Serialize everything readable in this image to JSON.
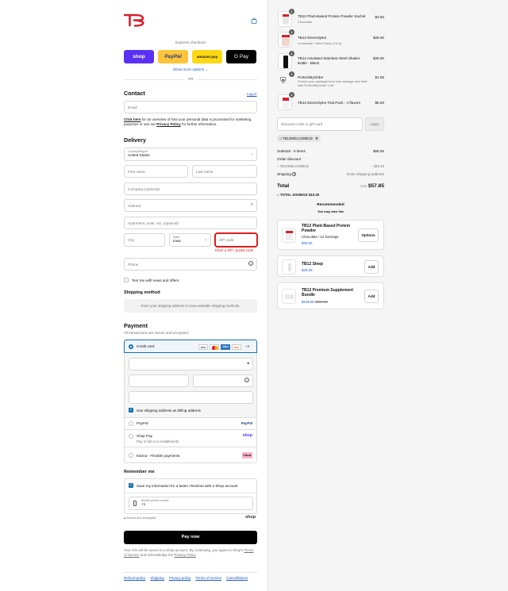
{
  "header": {
    "logo_text": "TB12",
    "cart_icon": "shopping-bag-icon"
  },
  "express": {
    "label": "Express checkout",
    "shop_label": "shop",
    "paypal_label": "PayPal",
    "amazon_label": "amazon pay",
    "gpay_label": "G Pay",
    "show_more": "Show more options",
    "or": "OR"
  },
  "contact": {
    "heading": "Contact",
    "login": "Log in",
    "email_placeholder": "Email",
    "privacy_prefix": "Click here",
    "privacy_text": " for an overview of how your personal data is processed for marketing purposes or see our ",
    "privacy_link": "Privacy Policy",
    "privacy_suffix": " for further information."
  },
  "delivery": {
    "heading": "Delivery",
    "country_label": "Country/Region",
    "country_value": "United States",
    "first_name": "First name",
    "last_name": "Last name",
    "company": "Company (optional)",
    "address": "Address",
    "apartment": "Apartment, suite, etc. (optional)",
    "city": "City",
    "state_label": "State",
    "state_value": "Iowa",
    "zip": "ZIP code",
    "zip_error": "Enter a ZIP / postal code",
    "phone": "Phone",
    "news_label": "Text me with news and offers"
  },
  "shipping": {
    "heading": "Shipping method",
    "notice": "Enter your shipping address to view available shipping methods."
  },
  "payment": {
    "heading": "Payment",
    "subtitle": "All transactions are secure and encrypted.",
    "credit_card": "Credit card",
    "card_brands": [
      "VISA",
      "MC",
      "AMEX",
      "DISC"
    ],
    "more_brands": "+4",
    "billing_label": "Use shipping address as billing address",
    "paypal": "PayPal",
    "paypal_logo": "PayPal",
    "shop_pay": "Shop Pay",
    "shop_pay_sub": "Pay in full or in installments",
    "shop_pay_logo": "shop",
    "klarna": "Klarna - Flexible payments",
    "klarna_logo": "Klarna"
  },
  "remember": {
    "heading": "Remember me",
    "save_label": "Save my information for a faster checkout with a Shop account",
    "phone_label": "Mobile phone number",
    "phone_value": "+1",
    "secure": "Secure and encrypted",
    "shop_logo": "shop"
  },
  "pay_button": "Pay now",
  "legal": {
    "text": "Your info will be saved to a Shop account. By continuing, you agree to Shop's ",
    "terms": "Terms of Service",
    "mid": " and acknowledge the ",
    "privacy": "Privacy Policy",
    "end": "."
  },
  "footer": [
    "Refund policy",
    "Shipping",
    "Privacy policy",
    "Terms of service",
    "Cancellations"
  ],
  "cart": {
    "items": [
      {
        "qty": "1",
        "title": "TB12 Plant-Based Protein Powder Sachet",
        "sub": "Chocolate",
        "price": "$3.50"
      },
      {
        "qty": "1",
        "title": "TB12 Electrolytes",
        "sub": "Lemonade / Stick Packs (15 ct)",
        "price": "$28.00"
      },
      {
        "qty": "1",
        "title": "TB12 Insulated Stainless Steel Shaker Bottle - Black",
        "sub": "",
        "price": "$30.00"
      },
      {
        "qty": "1",
        "title": "ProtectMyOrder",
        "sub": "Protect your package from loss damage and theft with ProtectMyOrder 1.55",
        "price": "$1.55"
      },
      {
        "qty": "1",
        "title": "TB12 Electrolytes Trial Pack - 4 flavors",
        "sub": "",
        "price": "$5.00"
      }
    ],
    "discount_placeholder": "Discount code or gift card",
    "apply": "Apply",
    "applied_code": "TB12WELCOME15",
    "subtotal_label": "Subtotal · 5 items",
    "subtotal": "$68.05",
    "order_discount_label": "Order discount",
    "discount_code": "TB12WELCOME15",
    "discount_value": "- $10.20",
    "shipping_label": "Shipping",
    "shipping_value": "Enter shipping address",
    "total_label": "Total",
    "currency": "USD",
    "total": "$57.85",
    "savings_label": "TOTAL SAVINGS",
    "savings": "$10.20"
  },
  "recommended": {
    "heading": "Recommended",
    "sub": "You may also like",
    "items": [
      {
        "title": "TB12 Plant-Based Protein Powder",
        "variant": "Chocolate / 12 Servings",
        "price": "$34.00",
        "old_price": "",
        "button": "Options"
      },
      {
        "title": "TB12 Sleep",
        "variant": "",
        "price": "$40.00",
        "old_price": "",
        "button": "Add"
      },
      {
        "title": "TB12 Premium Supplement Bundle",
        "variant": "",
        "price": "$149.00",
        "old_price": "$205.00",
        "button": "Add"
      }
    ]
  },
  "colors": {
    "shop": "#5a31f4",
    "paypal": "#ffc439",
    "amazon": "#ffd814",
    "gpay": "#000000",
    "error": "#dd1d1d",
    "link": "#1a55c9",
    "brand_red": "#d7202a"
  }
}
